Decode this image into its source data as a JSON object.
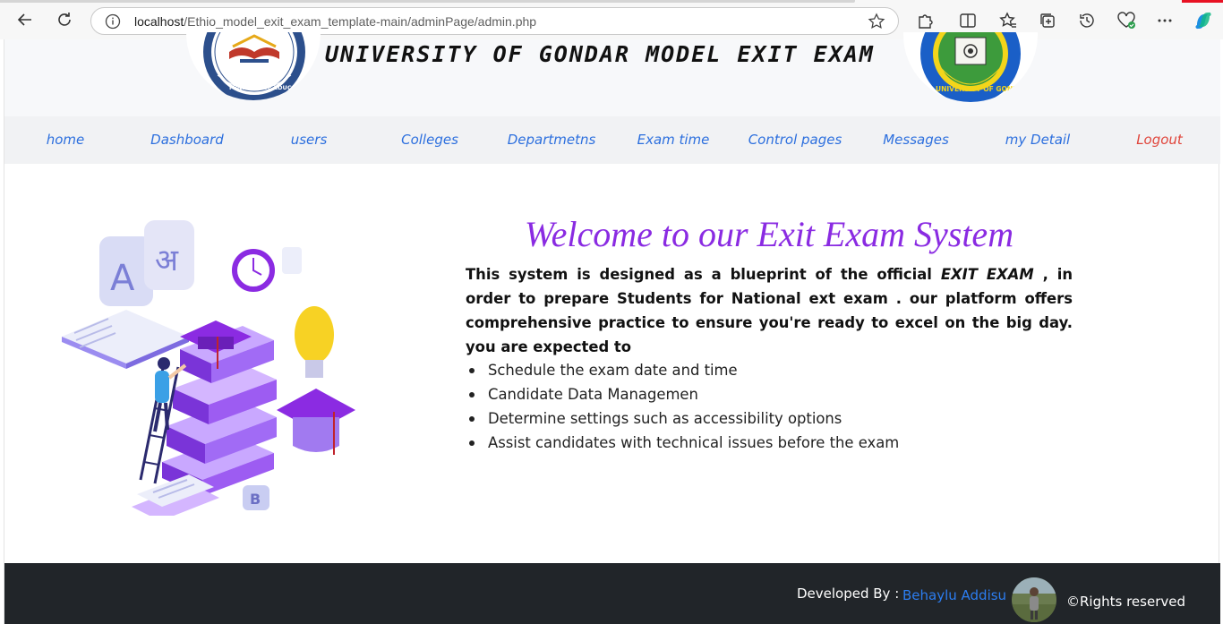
{
  "browser": {
    "url_host": "localhost",
    "url_path": "/Ethio_model_exit_exam_template-main/adminPage/admin.php"
  },
  "header": {
    "title": "UNIVERSITY OF GONDAR MODEL EXIT EXAM",
    "left_logo": {
      "icon": "ministry-of-education-seal",
      "ring_text": "MINISTRY OF EDUCATION"
    },
    "right_logo": {
      "icon": "university-of-gondar-seal",
      "ring_text": "UNIVERSITY OF GONDAR"
    }
  },
  "nav": {
    "items": [
      {
        "label": "home"
      },
      {
        "label": "Dashboard"
      },
      {
        "label": "users"
      },
      {
        "label": "Colleges"
      },
      {
        "label": "Departmetns"
      },
      {
        "label": "Exam time"
      },
      {
        "label": "Control pages"
      },
      {
        "label": "Messages"
      },
      {
        "label": "my Detail"
      },
      {
        "label": "Logout"
      }
    ]
  },
  "main": {
    "welcome": "Welcome to our Exit Exam System",
    "intro_before": "This system is designed as a blueprint of the official ",
    "intro_emphasis": "EXIT EXAM",
    "intro_after": " , in order to prepare Students for National ext exam . our platform offers comprehensive practice to ensure you're ready to excel on the big day. you are expected to",
    "bullets": [
      "Schedule the exam date and time",
      "Candidate Data Managemen",
      "Determine settings such as accessibility options",
      "Assist candidates with technical issues before the exam"
    ]
  },
  "footer": {
    "developed_by_label": "Developed By :",
    "developer_name": "Behaylu Addisu",
    "rights": "©Rights reserved"
  },
  "colors": {
    "nav_link": "#2c6fde",
    "logout": "#e0453b",
    "welcome": "#8a2be2",
    "footer_bg": "#212529"
  }
}
